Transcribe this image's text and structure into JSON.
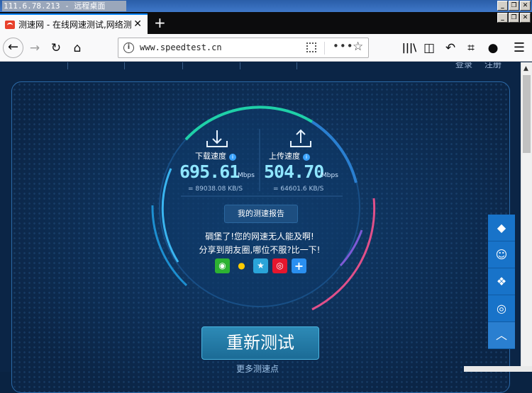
{
  "rdp": {
    "title": "111.6.78.213 - 远程桌面"
  },
  "window_buttons": [
    "_",
    "❐",
    "✕"
  ],
  "tab": {
    "label": "测速网 - 在线网速测试,网络测速"
  },
  "url": "www.speedtest.cn",
  "page": {
    "login": "登录",
    "register": "注册",
    "download": {
      "label": "下载速度",
      "value": "695.61",
      "unit": "Mbps",
      "sub": "= 89038.08 KB/S"
    },
    "upload": {
      "label": "上传速度",
      "value": "504.70",
      "unit": "Mbps",
      "sub": "= 64601.6 KB/S"
    },
    "report_button": "我的测速报告",
    "message1": "碉堡了!您的网速无人能及啊!",
    "message2": "分享到朋友圈,哪位不服?比一下!",
    "retest_button": "重新测试",
    "more_nodes": "更多测速点"
  },
  "share_icons": [
    "wechat-icon",
    "qq-icon",
    "qzone-icon",
    "weibo-icon",
    "plus-icon"
  ],
  "side_rail_icons": [
    "qq-icon",
    "contacts-icon",
    "wechat-icon",
    "weibo-icon",
    "back-to-top-icon"
  ],
  "colors": {
    "accent": "#0a84ff",
    "panel_border": "#2c6aa8",
    "digits": "#8fe6ff",
    "rail": "#1873c9"
  }
}
